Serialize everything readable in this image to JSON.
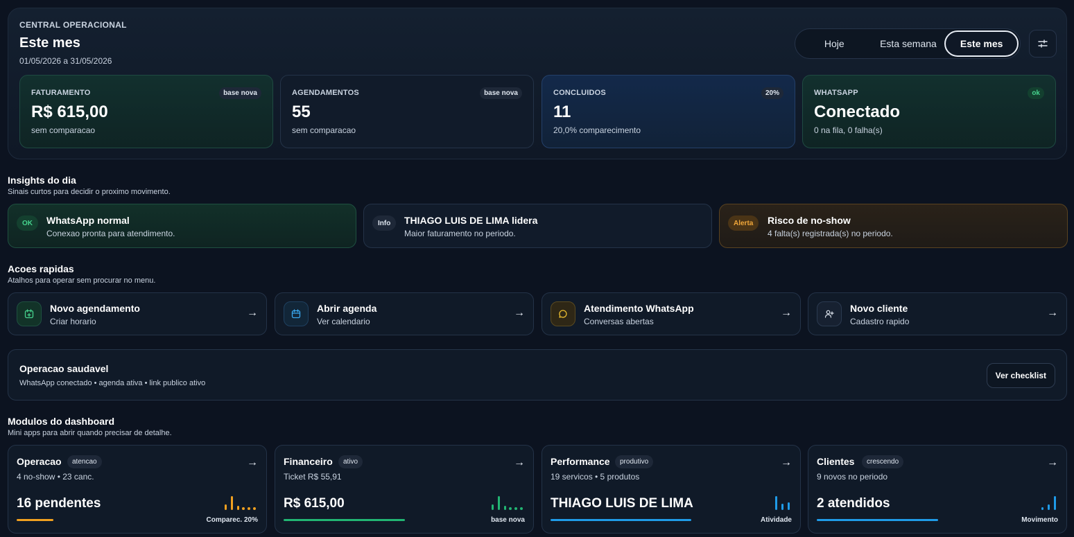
{
  "header": {
    "eyebrow": "CENTRAL OPERACIONAL",
    "title": "Este mes",
    "range": "01/05/2026 a 31/05/2026",
    "periods": [
      "Hoje",
      "Esta semana",
      "Este mes"
    ],
    "active_period": "Este mes"
  },
  "kpis": [
    {
      "label": "FATURAMENTO",
      "value": "R$ 615,00",
      "sub": "sem comparacao",
      "badge": "base nova"
    },
    {
      "label": "AGENDAMENTOS",
      "value": "55",
      "sub": "sem comparacao",
      "badge": "base nova"
    },
    {
      "label": "CONCLUIDOS",
      "value": "11",
      "sub": "20,0% comparecimento",
      "badge": "20%"
    },
    {
      "label": "WHATSAPP",
      "value": "Conectado",
      "sub": "0 na fila, 0 falha(s)",
      "badge": "ok"
    }
  ],
  "insights": {
    "title": "Insights do dia",
    "subtitle": "Sinais curtos para decidir o proximo movimento.",
    "items": [
      {
        "tag": "OK",
        "title": "WhatsApp normal",
        "desc": "Conexao pronta para atendimento."
      },
      {
        "tag": "Info",
        "title": "THIAGO LUIS DE LIMA lidera",
        "desc": "Maior faturamento no periodo."
      },
      {
        "tag": "Alerta",
        "title": "Risco de no-show",
        "desc": "4 falta(s) registrada(s) no periodo."
      }
    ]
  },
  "actions": {
    "title": "Acoes rapidas",
    "subtitle": "Atalhos para operar sem procurar no menu.",
    "items": [
      {
        "title": "Novo agendamento",
        "desc": "Criar horario",
        "icon": "calendar-plus-icon",
        "arrow": "→"
      },
      {
        "title": "Abrir agenda",
        "desc": "Ver calendario",
        "icon": "calendar-icon",
        "arrow": "→"
      },
      {
        "title": "Atendimento WhatsApp",
        "desc": "Conversas abertas",
        "icon": "chat-bubble-icon",
        "arrow": "→"
      },
      {
        "title": "Novo cliente",
        "desc": "Cadastro rapido",
        "icon": "user-plus-icon",
        "arrow": "→"
      }
    ]
  },
  "health": {
    "title": "Operacao saudavel",
    "desc": "WhatsApp conectado • agenda ativa • link publico ativo",
    "button": "Ver checklist"
  },
  "modules": {
    "title": "Modulos do dashboard",
    "subtitle": "Mini apps para abrir quando precisar de detalhe.",
    "items": [
      {
        "title": "Operacao",
        "pill": "atencao",
        "desc": "4 no-show • 23 canc.",
        "big": "16 pendentes",
        "foot": "Comparec. 20%",
        "color": "#f0a020",
        "progress": 0.15,
        "arrow": "→"
      },
      {
        "title": "Financeiro",
        "pill": "ativo",
        "desc": "Ticket R$ 55,91",
        "big": "R$ 615,00",
        "foot": "base nova",
        "color": "#22b573",
        "progress": 0.5,
        "arrow": "→"
      },
      {
        "title": "Performance",
        "pill": "produtivo",
        "desc": "19 servicos • 5 produtos",
        "big": "THIAGO LUIS DE LIMA",
        "foot": "Atividade",
        "color": "#1f9be8",
        "progress": 0.58,
        "arrow": "→"
      },
      {
        "title": "Clientes",
        "pill": "crescendo",
        "desc": "9 novos no periodo",
        "big": "2 atendidos",
        "foot": "Movimento",
        "color": "#1f9be8",
        "progress": 0.5,
        "arrow": "→"
      }
    ]
  }
}
